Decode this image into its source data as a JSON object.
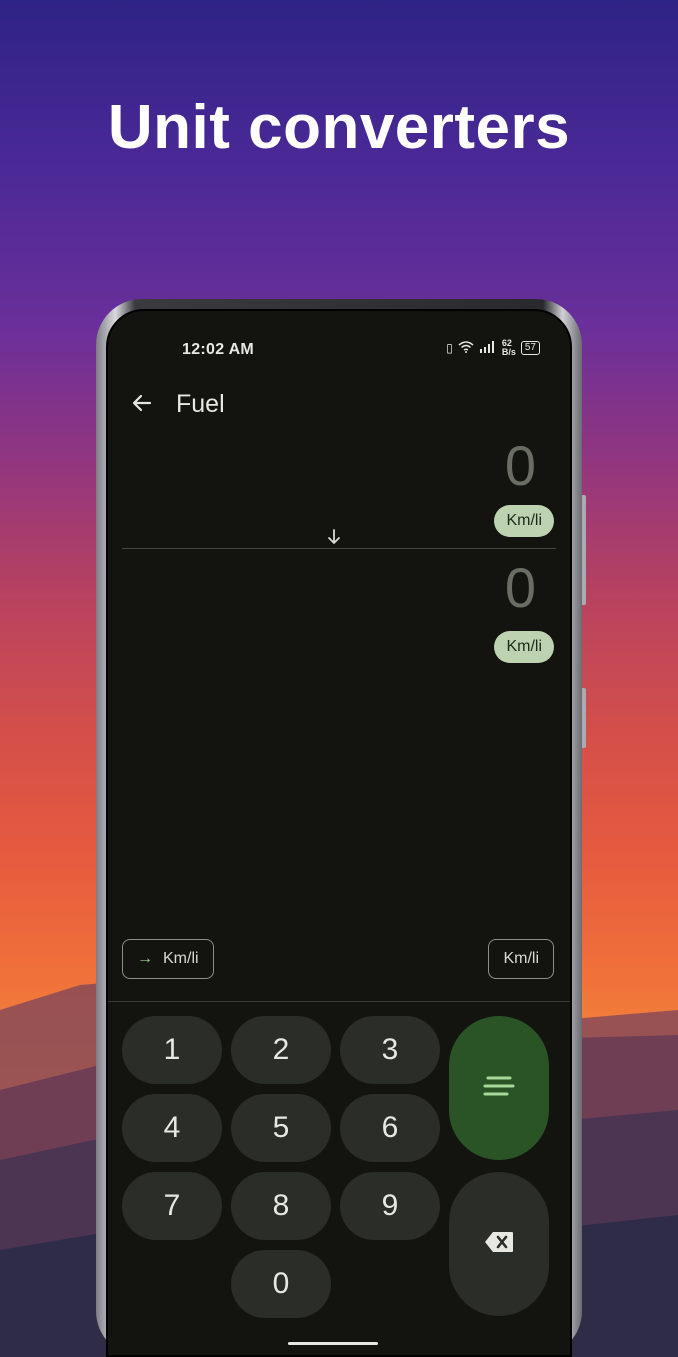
{
  "headline": "Unit converters",
  "status_bar": {
    "time": "12:02 AM",
    "speed_top": "62",
    "speed_unit": "B/s",
    "battery": "57"
  },
  "app_bar": {
    "title": "Fuel",
    "back_icon": "arrow-left-icon"
  },
  "converter": {
    "input_value": "0",
    "input_unit": "Km/li",
    "output_value": "0",
    "output_unit": "Km/li",
    "swap_icon": "arrow-down-icon"
  },
  "unit_buttons": {
    "from_label": "Km/li",
    "to_label": "Km/li"
  },
  "keypad": {
    "keys": [
      "1",
      "2",
      "3",
      "4",
      "5",
      "6",
      "7",
      "8",
      "9",
      "0"
    ],
    "equals_icon": "equals-lines-icon",
    "delete_icon": "backspace-icon"
  },
  "colors": {
    "screen_bg": "#131410",
    "chip_bg": "#bcd2b0",
    "key_bg": "#2b2d28",
    "equals_bg": "#2a5426",
    "accent_arrow": "#9fd190"
  }
}
